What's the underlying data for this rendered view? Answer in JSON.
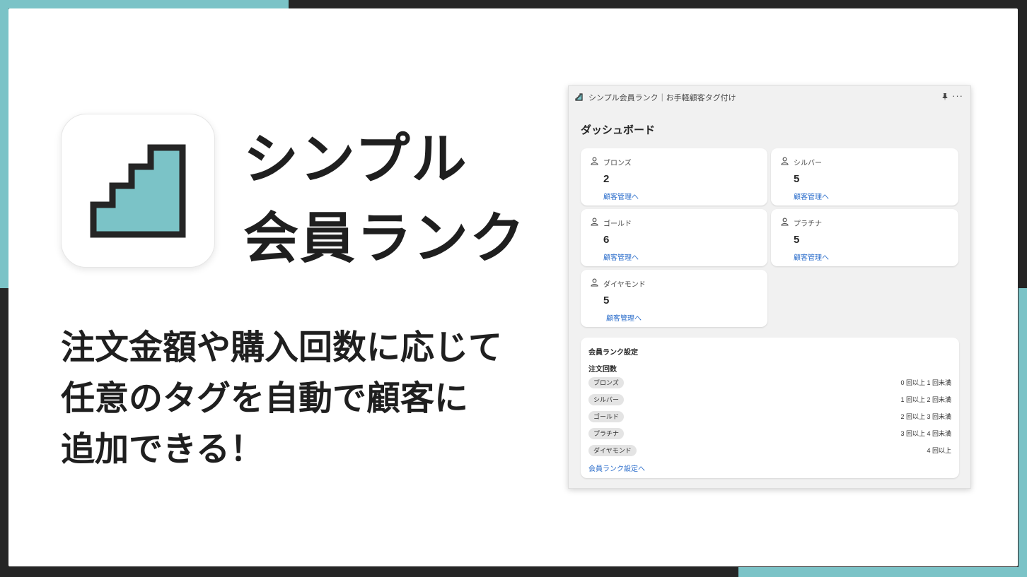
{
  "colors": {
    "accent": "#7bc3c7",
    "frame_dark": "#252525",
    "link": "#2c6ecb"
  },
  "hero": {
    "app_icon": "staircase-icon",
    "title_line1": "シンプル",
    "title_line2": "会員ランク",
    "desc_line1": "注文金額や購入回数に応じて",
    "desc_line2": "任意のタグを自動で顧客に",
    "desc_line3": "追加できる！"
  },
  "admin": {
    "window_title": "シンプル会員ランク｜お手軽顧客タグ付け",
    "pin_icon": "pin-icon",
    "more_label": "···",
    "dashboard_heading": "ダッシュボード",
    "rank_cards": [
      {
        "name": "ブロンズ",
        "count": "2",
        "link": "顧客管理へ"
      },
      {
        "name": "シルバー",
        "count": "5",
        "link": "顧客管理へ"
      },
      {
        "name": "ゴールド",
        "count": "6",
        "link": "顧客管理へ"
      },
      {
        "name": "プラチナ",
        "count": "5",
        "link": "顧客管理へ"
      },
      {
        "name": "ダイヤモンド",
        "count": "5",
        "link": "顧客管理へ"
      }
    ],
    "settings": {
      "title": "会員ランク設定",
      "subtitle": "注文回数",
      "rows": [
        {
          "rank": "ブロンズ",
          "range": "0 回以上 1 回未満"
        },
        {
          "rank": "シルバー",
          "range": "1 回以上 2 回未満"
        },
        {
          "rank": "ゴールド",
          "range": "2 回以上 3 回未満"
        },
        {
          "rank": "プラチナ",
          "range": "3 回以上 4 回未満"
        },
        {
          "rank": "ダイヤモンド",
          "range": "4 回以上"
        }
      ],
      "link": "会員ランク設定へ"
    }
  }
}
